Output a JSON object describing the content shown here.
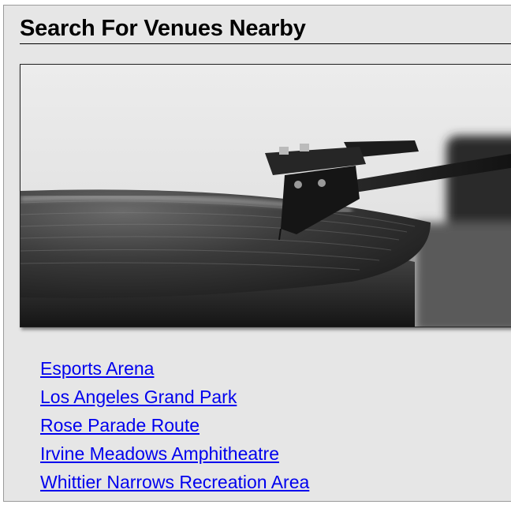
{
  "page": {
    "title": "Search For Venues Nearby"
  },
  "hero_image": {
    "icon": "record-turntable-photo"
  },
  "venues": [
    {
      "label": "Esports Arena"
    },
    {
      "label": "Los Angeles Grand Park"
    },
    {
      "label": "Rose Parade Route"
    },
    {
      "label": "Irvine Meadows Amphitheatre"
    },
    {
      "label": "Whittier Narrows Recreation Area"
    }
  ]
}
